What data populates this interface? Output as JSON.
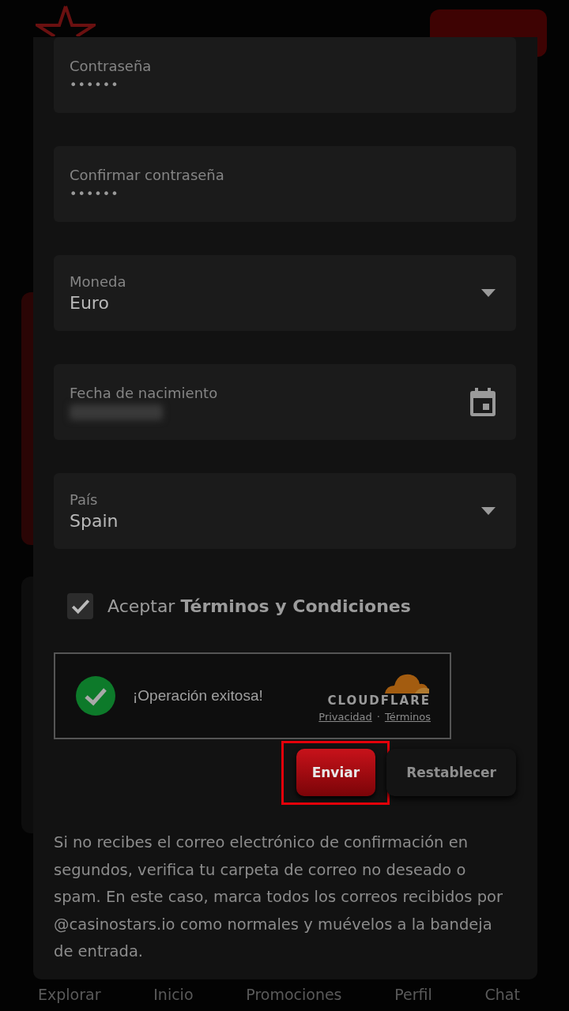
{
  "form": {
    "fields": [
      {
        "kind": "password",
        "label": "Contraseña",
        "value": "••••••"
      },
      {
        "kind": "password",
        "label": "Confirmar contraseña",
        "value": "••••••"
      },
      {
        "kind": "select",
        "label": "Moneda",
        "value": "Euro"
      },
      {
        "kind": "date",
        "label": "Fecha de nacimiento"
      },
      {
        "kind": "select",
        "label": "País",
        "value": "Spain"
      }
    ],
    "terms": {
      "checked": true,
      "text": "Aceptar **Términos y Condiciones**"
    },
    "captcha": {
      "verified": true,
      "status": "¡Operación exitosa!",
      "brand": "CLOUDFLARE",
      "links": [
        "Privacidad",
        "Términos"
      ],
      "separator": "·"
    },
    "buttons": [
      {
        "label": "Enviar",
        "kind": "primary",
        "highlighted": true
      },
      {
        "label": "Restablecer",
        "kind": "secondary",
        "highlighted": false
      }
    ],
    "note": "Si no recibes el correo electrónico de confirmación en segundos, verifica tu carpeta de correo no deseado o spam. En este caso, marca todos los correos recibidos por @casinostars.io como normales y muévelos a la bandeja de entrada."
  },
  "bottom_nav": [
    "Explorar",
    "Inicio",
    "Promociones",
    "Perfil",
    "Chat"
  ]
}
